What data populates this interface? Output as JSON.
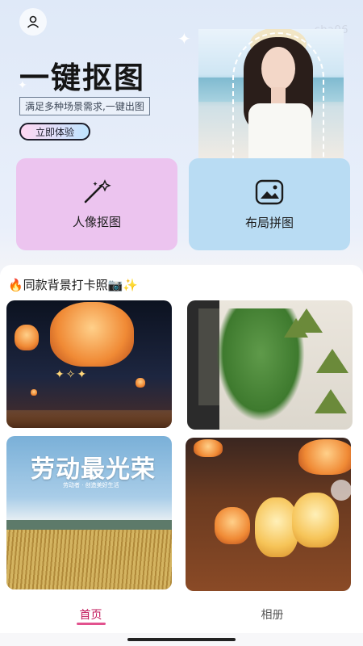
{
  "watermark": "cba06",
  "hero": {
    "title": "一键抠图",
    "subtitle": "满足多种场景需求,一键出图",
    "cta_label": "立即体验"
  },
  "feature_cards": [
    {
      "label": "人像抠图",
      "icon": "magic-wand-icon",
      "color": "#ecc4ef"
    },
    {
      "label": "布局拼图",
      "icon": "image-icon",
      "color": "#b9dcf3"
    }
  ],
  "section": {
    "title": "🔥同款背景打卡照📷✨"
  },
  "gallery": {
    "tile3_title": "劳动最光荣",
    "tile3_subtitle": "劳动者 · 创造美好生活"
  },
  "tabbar": {
    "tabs": [
      {
        "label": "首页",
        "active": true
      },
      {
        "label": "相册",
        "active": false
      }
    ],
    "accent": "#e2528e"
  }
}
